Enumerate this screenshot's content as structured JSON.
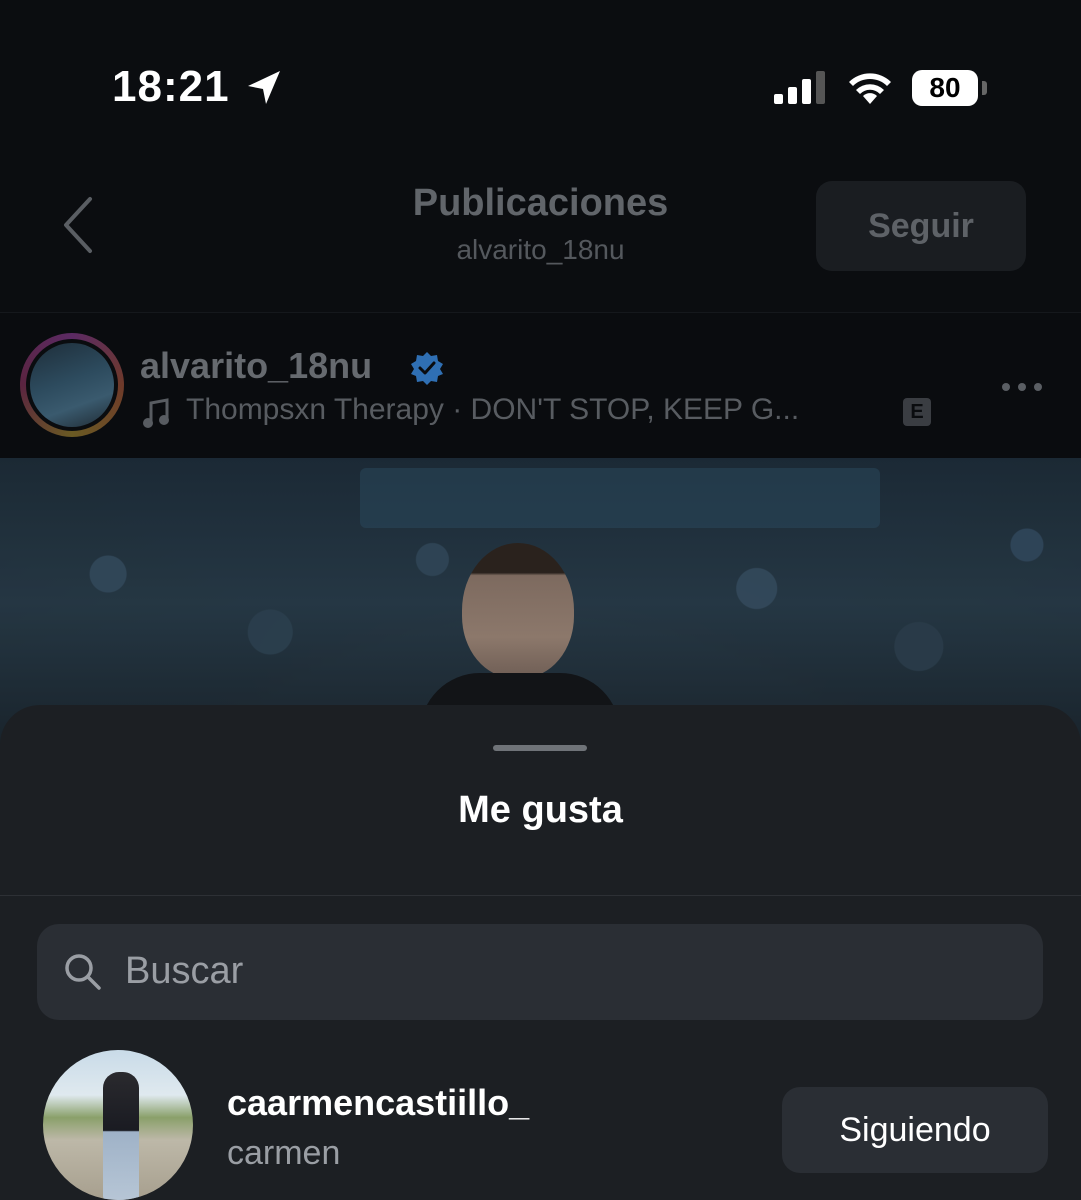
{
  "status_bar": {
    "time": "18:21",
    "battery": "80",
    "icons": [
      "location-arrow-icon",
      "signal-icon",
      "wifi-icon",
      "battery-icon"
    ]
  },
  "header": {
    "title": "Publicaciones",
    "subtitle": "alvarito_18nu",
    "follow_label": "Seguir"
  },
  "post": {
    "username": "alvarito_18nu",
    "verified": true,
    "song": "Thompsxn Therapy · DON'T STOP, KEEP G...",
    "explicit_badge": "E"
  },
  "likes_sheet": {
    "title": "Me gusta",
    "search_placeholder": "Buscar",
    "users": [
      {
        "username": "caarmencastiillo_",
        "name": "carmen",
        "button_label": "Siguiendo"
      }
    ]
  },
  "colors": {
    "background": "#0b0d10",
    "sheet": "#1c1f23",
    "search_field": "#2a2e34",
    "verified_blue": "#2f6fb3"
  }
}
